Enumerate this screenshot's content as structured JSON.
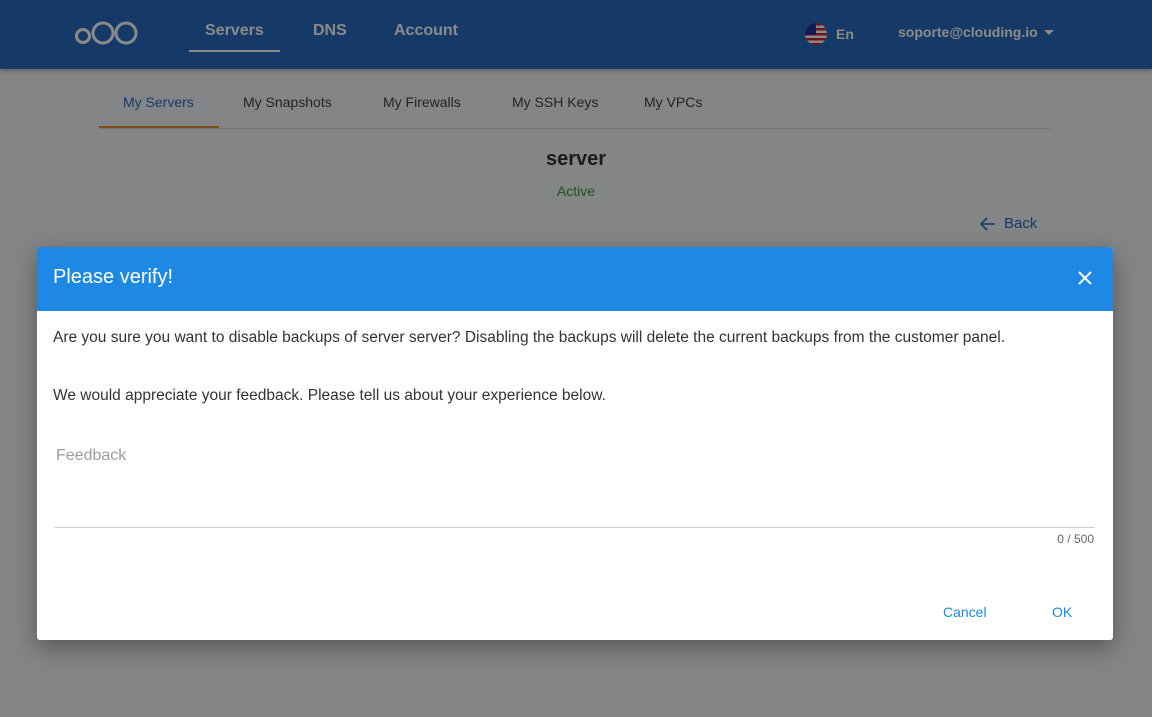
{
  "topbar": {
    "nav": [
      "Servers",
      "DNS",
      "Account"
    ],
    "active_nav": "Servers",
    "language": "En",
    "user": "soporte@clouding.io"
  },
  "subtabs": [
    "My Servers",
    "My Snapshots",
    "My Firewalls",
    "My SSH Keys",
    "My VPCs"
  ],
  "server": {
    "name": "server",
    "status": "Active"
  },
  "back_label": "Back",
  "dialog": {
    "title": "Please verify!",
    "message": "Are you sure you want to disable backups of server server? Disabling the backups will delete the current backups from the customer panel.",
    "feedback_prompt": "We would appreciate your feedback. Please tell us about your experience below.",
    "feedback_placeholder": "Feedback",
    "feedback_value": "",
    "counter": "0 / 500",
    "cancel_label": "Cancel",
    "ok_label": "OK"
  },
  "colors": {
    "topbar": "#2a6cc0",
    "dialog_header": "#1e88e5",
    "active_status": "#3a9a3a",
    "tab_underline": "#e8922b"
  }
}
